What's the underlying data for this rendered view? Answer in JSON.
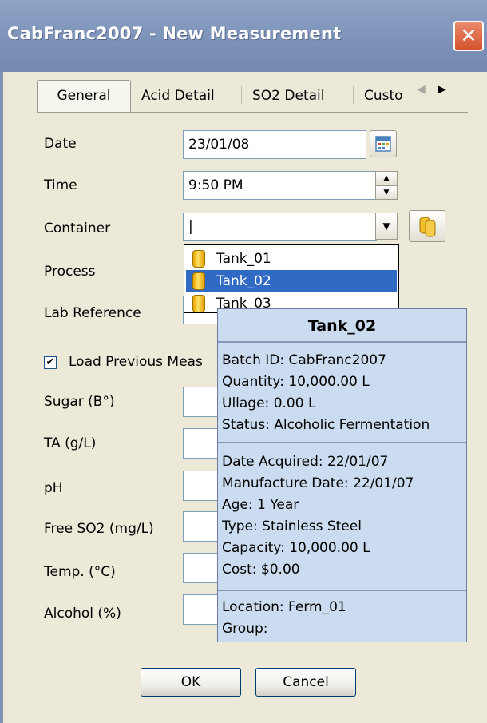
{
  "window": {
    "title": "CabFranc2007 - New Measurement"
  },
  "tabs": [
    {
      "label": "General"
    },
    {
      "label": "Acid Detail"
    },
    {
      "label": "SO2 Detail"
    },
    {
      "label": "Custo"
    }
  ],
  "form": {
    "date_label": "Date",
    "date_value": "23/01/08",
    "time_label": "Time",
    "time_value": "9:50 PM",
    "container_label": "Container",
    "container_value": "|",
    "process_label": "Process",
    "lab_reference_label": "Lab Reference",
    "load_previous_label": "Load Previous Meas",
    "load_previous_checked": true,
    "sugar_label": "Sugar (B°)",
    "ta_label": "TA (g/L)",
    "ph_label": "pH",
    "free_so2_label": "Free SO2 (mg/L)",
    "temp_label": "Temp. (°C)",
    "alcohol_label": "Alcohol (%)"
  },
  "dropdown": {
    "items": [
      "Tank_01",
      "Tank_02",
      "Tank_03"
    ],
    "selected": "Tank_02"
  },
  "tooltip": {
    "title": "Tank_02",
    "section1": [
      "Batch ID:  CabFranc2007",
      "Quantity:  10,000.00 L",
      "Ullage:  0.00 L",
      "Status:  Alcoholic Fermentation"
    ],
    "section2": [
      "Date Acquired:  22/01/07",
      "Manufacture Date:  22/01/07",
      "Age:  1 Year",
      "Type:  Stainless Steel",
      "Capacity:  10,000.00 L",
      "Cost:  $0.00"
    ],
    "section3": [
      "Location:  Ferm_01",
      "Group:"
    ]
  },
  "buttons": {
    "ok": "OK",
    "cancel": "Cancel"
  },
  "colors": {
    "titlebar": "#7E93B9",
    "selection": "#316AC5",
    "tooltip_bg": "#CCDCF0",
    "dialog_bg": "#ECE9D8"
  }
}
